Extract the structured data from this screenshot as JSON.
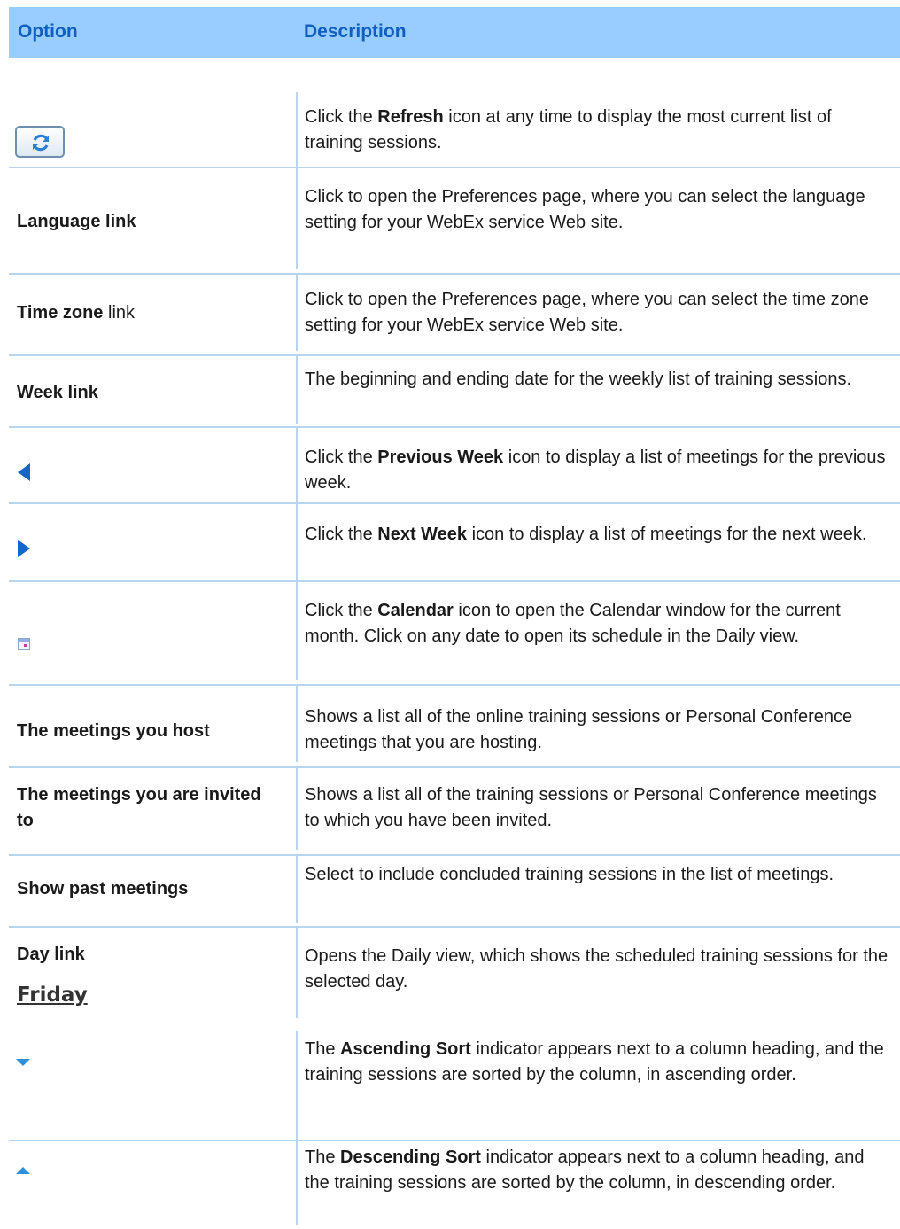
{
  "table": {
    "header": {
      "option": "Option",
      "description": "Description"
    },
    "rows": [
      {
        "option_icon": "refresh-icon",
        "desc": [
          "Click the ",
          "Refresh",
          " icon at any time to display the most current list of training sessions."
        ]
      },
      {
        "option": "Language link",
        "desc": "Click to open the Preferences page, where you can select the language setting for your WebEx service Web site."
      },
      {
        "option_bold": "Time zone",
        "option_rest": " link",
        "desc": "Click to open the Preferences page, where you can select the time zone setting for your WebEx service Web site."
      },
      {
        "option": "Week link",
        "desc": "The beginning and ending date for the weekly list of training sessions."
      },
      {
        "option_icon": "previous-week-icon",
        "desc": [
          "Click the ",
          "Previous Week",
          " icon to display a list of meetings for the previous week."
        ]
      },
      {
        "option_icon": "next-week-icon",
        "desc": [
          "Click the ",
          "Next Week",
          " icon to display a list of meetings for the next week."
        ]
      },
      {
        "option_icon": "calendar-icon",
        "desc": [
          "Click the ",
          "Calendar",
          " icon to open the Calendar window for the current month. Click on any date to open its schedule in the Daily view."
        ]
      },
      {
        "option": "The meetings you host",
        "desc": "Shows a list all of the online training sessions or Personal Conference meetings that you are hosting."
      },
      {
        "option": "The meetings you are invited to",
        "desc": "Shows a list all of the training sessions or Personal Conference meetings to which you have been invited."
      },
      {
        "option": "Show past meetings",
        "desc": "Select to include concluded training sessions in the list of meetings."
      },
      {
        "option": "Day link",
        "option_sample": "Friday",
        "desc": "Opens the Daily view, which shows the scheduled training sessions for the selected day."
      },
      {
        "option_icon": "ascending-sort-icon",
        "desc": [
          "The ",
          "Ascending Sort",
          " indicator appears next to a column heading, and the training sessions are sorted by the column, in ascending order."
        ]
      },
      {
        "option_icon": "descending-sort-icon",
        "desc": [
          "The ",
          "Descending Sort",
          " indicator appears next to a column heading, and the training sessions are sorted by the column, in descending order."
        ]
      }
    ]
  }
}
